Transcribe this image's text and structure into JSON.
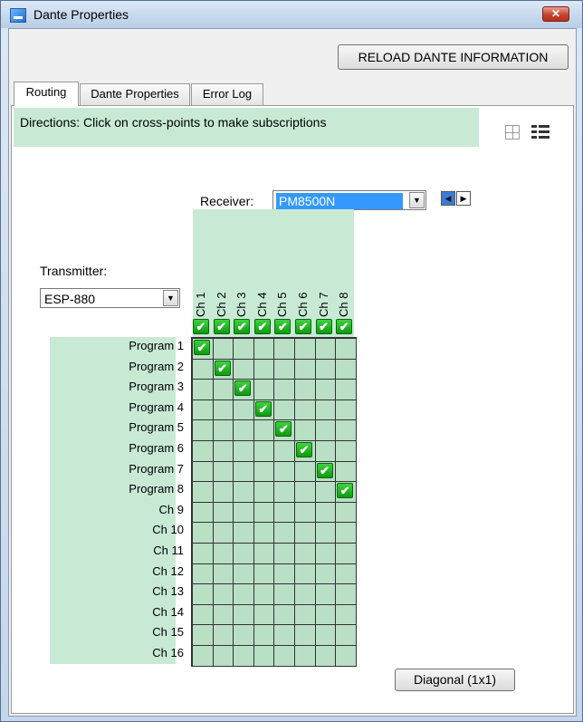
{
  "window": {
    "title": "Dante Properties",
    "close_glyph": "✕",
    "app_icon": "dante-app-icon"
  },
  "toolbar": {
    "reload_label": "RELOAD DANTE INFORMATION"
  },
  "tabs": [
    {
      "label": "Routing",
      "active": true
    },
    {
      "label": "Dante Properties",
      "active": false
    },
    {
      "label": "Error Log",
      "active": false
    }
  ],
  "routing": {
    "directions": "Directions: Click on cross-points to make subscriptions",
    "view_icons": [
      "grid-view-icon",
      "list-view-icon"
    ],
    "receiver_label": "Receiver:",
    "receiver_value": "PM8500N",
    "prev_glyph": "◀",
    "next_glyph": "▶",
    "transmitter_label": "Transmitter:",
    "transmitter_value": "ESP-880",
    "dropdown_glyph": "▼",
    "check_glyph": "✔",
    "receiver_channels": [
      "Ch 1",
      "Ch 2",
      "Ch 3",
      "Ch 4",
      "Ch 5",
      "Ch 6",
      "Ch 7",
      "Ch 8"
    ],
    "transmitter_channels": [
      "Program 1",
      "Program 2",
      "Program 3",
      "Program 4",
      "Program 5",
      "Program 6",
      "Program 7",
      "Program 8",
      "Ch 9",
      "Ch 10",
      "Ch 11",
      "Ch 12",
      "Ch 13",
      "Ch 14",
      "Ch 15",
      "Ch 16"
    ],
    "subscriptions": [
      [
        0,
        0
      ],
      [
        1,
        1
      ],
      [
        2,
        2
      ],
      [
        3,
        3
      ],
      [
        4,
        4
      ],
      [
        5,
        5
      ],
      [
        6,
        6
      ],
      [
        7,
        7
      ]
    ],
    "diagonal_label": "Diagonal (1x1)"
  },
  "colors": {
    "accent_green": "#c8ead5",
    "cell_green": "#b9dfc5",
    "check_green": "#17b017",
    "selection_blue": "#3399ff"
  }
}
